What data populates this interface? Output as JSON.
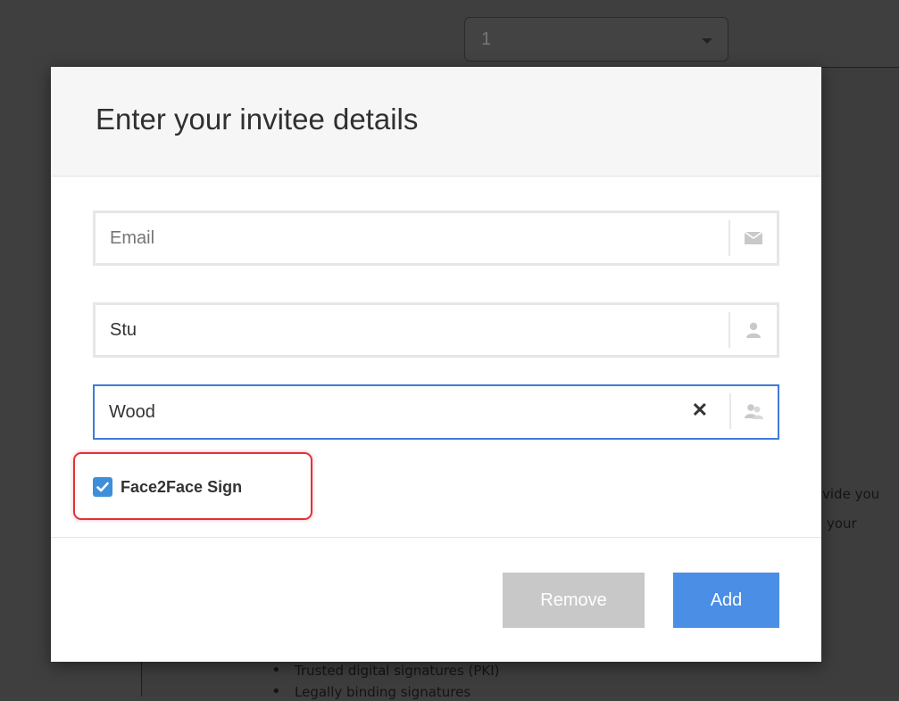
{
  "background": {
    "page_select_value": "1",
    "doc_text": [
      "vide you",
      "your"
    ],
    "bullets": [
      "Trusted digital signatures (PKI)",
      "Legally binding signatures"
    ]
  },
  "modal": {
    "title": "Enter your invitee details",
    "email": {
      "value": "",
      "placeholder": "Email",
      "icon": "envelope-icon"
    },
    "first_name": {
      "value": "Stu",
      "icon": "user-icon"
    },
    "last_name": {
      "value": "Wood",
      "icon": "users-icon"
    },
    "face2face": {
      "label": "Face2Face Sign",
      "checked": true
    },
    "remove_label": "Remove",
    "add_label": "Add"
  },
  "colors": {
    "accent": "#4a8ee5",
    "checkbox": "#3d8fd9",
    "highlight": "#e0323a",
    "disabled": "#c8c8c8"
  }
}
